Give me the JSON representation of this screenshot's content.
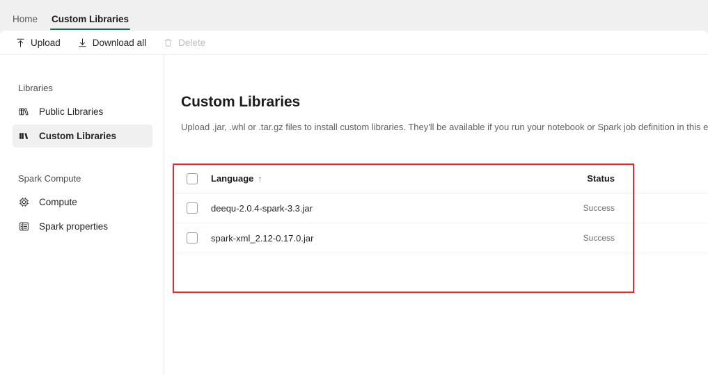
{
  "tabs": [
    {
      "label": "Home",
      "active": false
    },
    {
      "label": "Custom Libraries",
      "active": true
    }
  ],
  "toolbar": {
    "upload_label": "Upload",
    "download_all_label": "Download all",
    "delete_label": "Delete"
  },
  "sidebar": {
    "groups": [
      {
        "label": "Libraries",
        "items": [
          {
            "label": "Public Libraries",
            "icon": "public-libraries-icon",
            "selected": false
          },
          {
            "label": "Custom Libraries",
            "icon": "custom-libraries-icon",
            "selected": true
          }
        ]
      },
      {
        "label": "Spark Compute",
        "items": [
          {
            "label": "Compute",
            "icon": "compute-chip-icon",
            "selected": false
          },
          {
            "label": "Spark properties",
            "icon": "spark-properties-icon",
            "selected": false
          }
        ]
      }
    ]
  },
  "main": {
    "title": "Custom Libraries",
    "description": "Upload .jar, .whl or .tar.gz files to install custom libraries. They'll be available if you run your notebook or Spark job definition in this environment"
  },
  "table": {
    "columns": {
      "language": "Language",
      "sort_indicator": "↑",
      "status": "Status"
    },
    "rows": [
      {
        "name": "deequ-2.0.4-spark-3.3.jar",
        "status": "Success"
      },
      {
        "name": "spark-xml_2.12-0.17.0.jar",
        "status": "Success"
      }
    ]
  },
  "annotation": {
    "color": "#e8262b"
  },
  "colors": {
    "accent_tab_underline": "#0f6c5b",
    "selected_nav_bg": "#f0f0f0",
    "annotation_red": "#e8262b"
  }
}
